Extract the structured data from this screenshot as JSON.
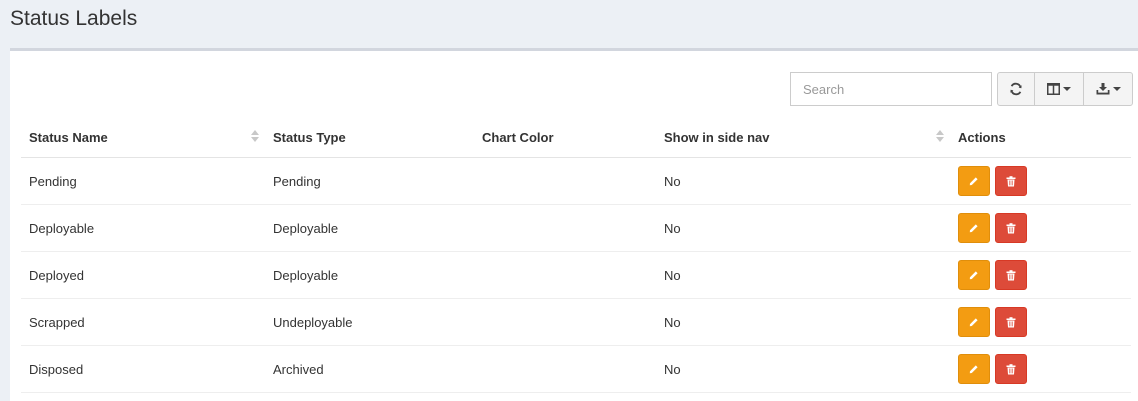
{
  "page": {
    "title": "Status Labels"
  },
  "toolbar": {
    "search_placeholder": "Search",
    "refresh_icon": "refresh-icon",
    "columns_icon": "columns-icon",
    "export_icon": "download-icon"
  },
  "table": {
    "headers": {
      "status_name": "Status Name",
      "status_type": "Status Type",
      "chart_color": "Chart Color",
      "show_in_nav": "Show in side nav",
      "actions": "Actions"
    },
    "rows": [
      {
        "name": "Pending",
        "type": "Pending",
        "color": "",
        "show_in_nav": "No"
      },
      {
        "name": "Deployable",
        "type": "Deployable",
        "color": "",
        "show_in_nav": "No"
      },
      {
        "name": "Deployed",
        "type": "Deployable",
        "color": "",
        "show_in_nav": "No"
      },
      {
        "name": "Scrapped",
        "type": "Undeployable",
        "color": "",
        "show_in_nav": "No"
      },
      {
        "name": "Disposed",
        "type": "Archived",
        "color": "",
        "show_in_nav": "No"
      }
    ]
  },
  "colors": {
    "edit_button": "#f39c12",
    "delete_button": "#dd4b39",
    "background": "#ecf0f5"
  }
}
